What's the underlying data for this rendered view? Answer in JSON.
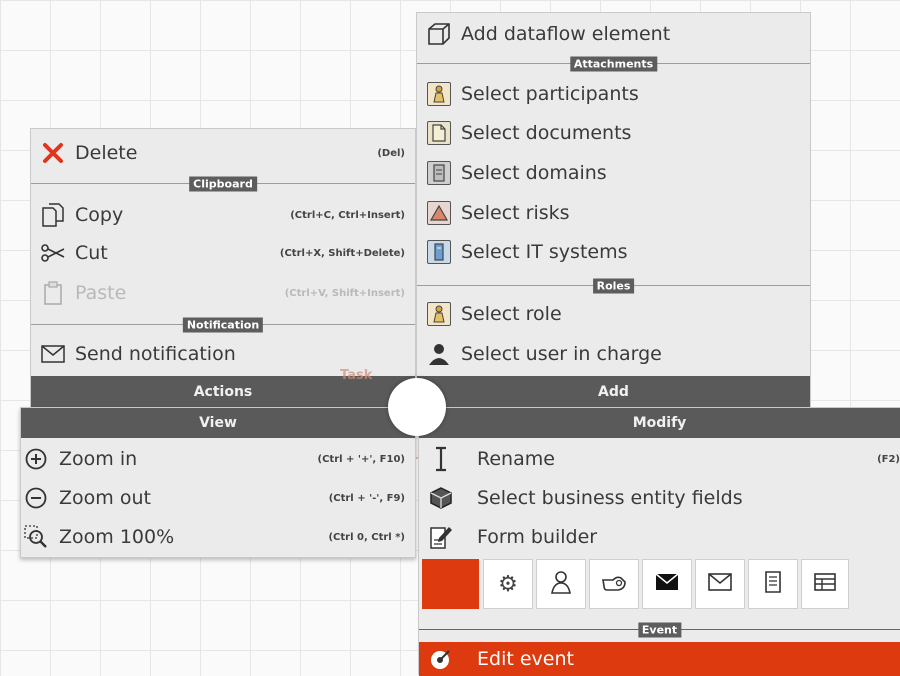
{
  "add_menu": {
    "top_item": "Add dataflow element",
    "attachments_label": "Attachments",
    "attachments": [
      "Select participants",
      "Select documents",
      "Select domains",
      "Select risks",
      "Select IT systems"
    ],
    "roles_label": "Roles",
    "roles": [
      "Select role",
      "Select user in charge"
    ],
    "footer": "Add"
  },
  "actions_menu": {
    "delete_label": "Delete",
    "delete_shortcut": "(Del)",
    "clipboard_label": "Clipboard",
    "copy_label": "Copy",
    "copy_shortcut": "(Ctrl+C, Ctrl+Insert)",
    "cut_label": "Cut",
    "cut_shortcut": "(Ctrl+X, Shift+Delete)",
    "paste_label": "Paste",
    "paste_shortcut": "(Ctrl+V, Shift+Insert)",
    "notification_label": "Notification",
    "send_notification_label": "Send notification",
    "footer": "Actions"
  },
  "canvas": {
    "task_label": "Task"
  },
  "view_menu": {
    "header": "View",
    "zoom_in_label": "Zoom in",
    "zoom_in_shortcut": "(Ctrl + '+', F10)",
    "zoom_out_label": "Zoom out",
    "zoom_out_shortcut": "(Ctrl + '-', F9)",
    "zoom_100_label": "Zoom 100%",
    "zoom_100_shortcut": "(Ctrl 0, Ctrl *)"
  },
  "modify_menu": {
    "header": "Modify",
    "rename_label": "Rename",
    "rename_shortcut": "(F2)",
    "fields_label": "Select business entity fields",
    "form_label": "Form builder",
    "event_label": "Event",
    "edit_event_label": "Edit event",
    "toolbar_icons": [
      "gear-icon",
      "user-icon",
      "hand-icon",
      "envelope-filled-icon",
      "envelope-icon",
      "script-icon",
      "table-icon"
    ]
  },
  "colors": {
    "accent": "#dd3a0f",
    "header_bg": "#5a5a5a",
    "panel_bg": "#ebebeb"
  }
}
